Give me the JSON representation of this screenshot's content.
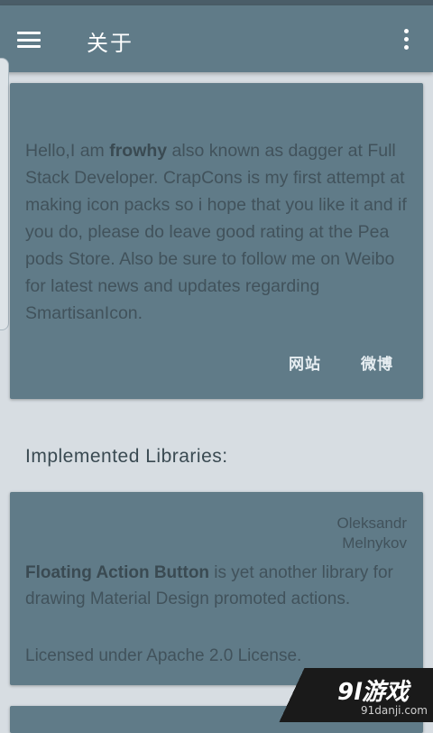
{
  "appbar": {
    "title": "关于",
    "menu_icon": "hamburger-menu-icon",
    "overflow_icon": "more-vert-icon"
  },
  "about": {
    "intro": "Hello,I am ",
    "name": "frowhy",
    "body": " also known as dagger at Full Stack Developer. CrapCons is my first attempt at making icon packs so i hope that you like it and if you do, please do leave good rating at the Pea pods Store. Also be sure to follow me on Weibo for latest news and updates regarding SmartisanIcon.",
    "website_label": "网站",
    "weibo_label": "微博"
  },
  "libraries": {
    "section_title": "Implemented Libraries:",
    "items": [
      {
        "author_first": "Oleksandr",
        "author_last": "Melnykov",
        "name": "Floating Action Button",
        "description": " is yet another library for drawing Material Design promoted actions.",
        "license": "Licensed under Apache 2.0 License."
      }
    ]
  },
  "watermark": {
    "logo": "9l游戏",
    "url": "91danji.com"
  },
  "colors": {
    "appbar": "#607b88",
    "card": "#607b88",
    "background": "#d7dde2",
    "text": "#41525b"
  }
}
